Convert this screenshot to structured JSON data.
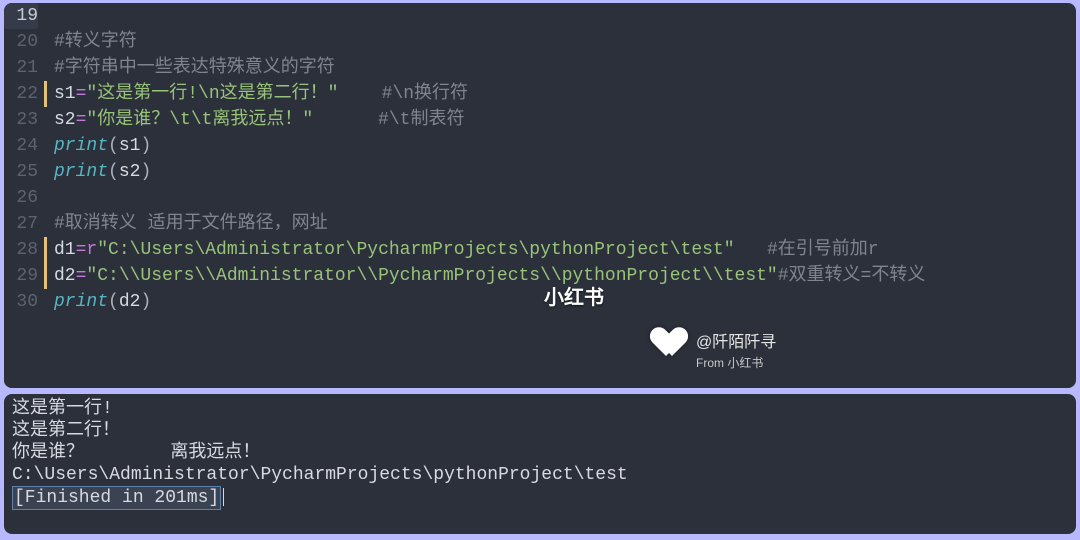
{
  "colors": {
    "bg": "#2b303b",
    "keyword": "#56b6c2",
    "string": "#98c379",
    "comment": "#7f848e"
  },
  "editor": {
    "line_start": 19,
    "line_end": 30,
    "current_line": 19,
    "marked_lines": [
      22,
      28,
      29
    ],
    "lines": {
      "l19": "",
      "l20_cmt": "#转义字符",
      "l21_cmt": "#字符串中一些表达特殊意义的字符",
      "l22_var": "s1",
      "l22_op": "=",
      "l22_str": "\"这是第一行!\\n这是第二行！\"",
      "l22_cmt": "    #\\n换行符",
      "l23_var": "s2",
      "l23_op": "=",
      "l23_str": "\"你是谁？\\t\\t离我远点！\"",
      "l23_cmt": "      #\\t制表符",
      "l24_kw": "print",
      "l24_open": "(",
      "l24_arg": "s1",
      "l24_close": ")",
      "l25_kw": "print",
      "l25_open": "(",
      "l25_arg": "s2",
      "l25_close": ")",
      "l27_cmt": "#取消转义 适用于文件路径，网址",
      "l28_var": "d1",
      "l28_op": "=",
      "l28_prefix": "r",
      "l28_str": "\"C:\\Users\\Administrator\\PycharmProjects\\pythonProject\\test\"",
      "l28_cmt": "   #在引号前加r",
      "l29_var": "d2",
      "l29_op": "=",
      "l29_str": "\"C:\\\\Users\\\\Administrator\\\\PycharmProjects\\\\pythonProject\\\\test\"",
      "l29_cmt": "#双重转义=不转义",
      "l30_kw": "print",
      "l30_open": "(",
      "l30_arg": "d2",
      "l30_close": ")"
    }
  },
  "watermark": {
    "center": "小红书",
    "user": "@阡陌阡寻",
    "from": "From 小红书"
  },
  "console": {
    "lines": [
      "这是第一行!",
      "这是第二行！",
      "你是谁？        离我远点！",
      "C:\\Users\\Administrator\\PycharmProjects\\pythonProject\\test"
    ],
    "finished": "[Finished in 201ms]"
  }
}
